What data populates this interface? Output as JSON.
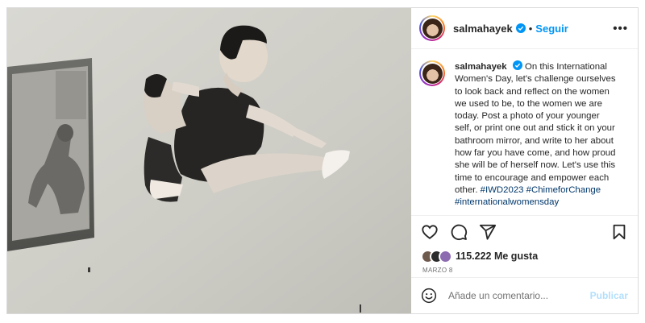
{
  "post": {
    "username": "salmahayek",
    "separator": "•",
    "follow_label": "Seguir",
    "more_label": "•••",
    "caption_username": "salmahayek",
    "caption_body": "On this International Women's Day, let's challenge ourselves to look back and reflect on the women we used to be, to the women we are today. Post a photo of your younger self, or print one out and stick it on your bathroom mirror, and write to her about how far you have come, and how proud she will be of herself now. Let's use this time to encourage and empower each other.",
    "hashtags": "#IWD2023 #ChimeforChange",
    "hashtags_partial": "#internationalwomensday",
    "likes": "115.222 Me gusta",
    "date": "MARZO 8"
  },
  "comment": {
    "placeholder": "Añade un comentario...",
    "publish_label": "Publicar"
  },
  "colors": {
    "accent": "#0095f6",
    "hashtag": "#00376b",
    "publish_disabled": "#b2dffc"
  },
  "icons": [
    "verified-badge-icon",
    "more-options-icon",
    "heart-icon",
    "comment-icon",
    "share-icon",
    "bookmark-icon",
    "emoji-icon"
  ]
}
